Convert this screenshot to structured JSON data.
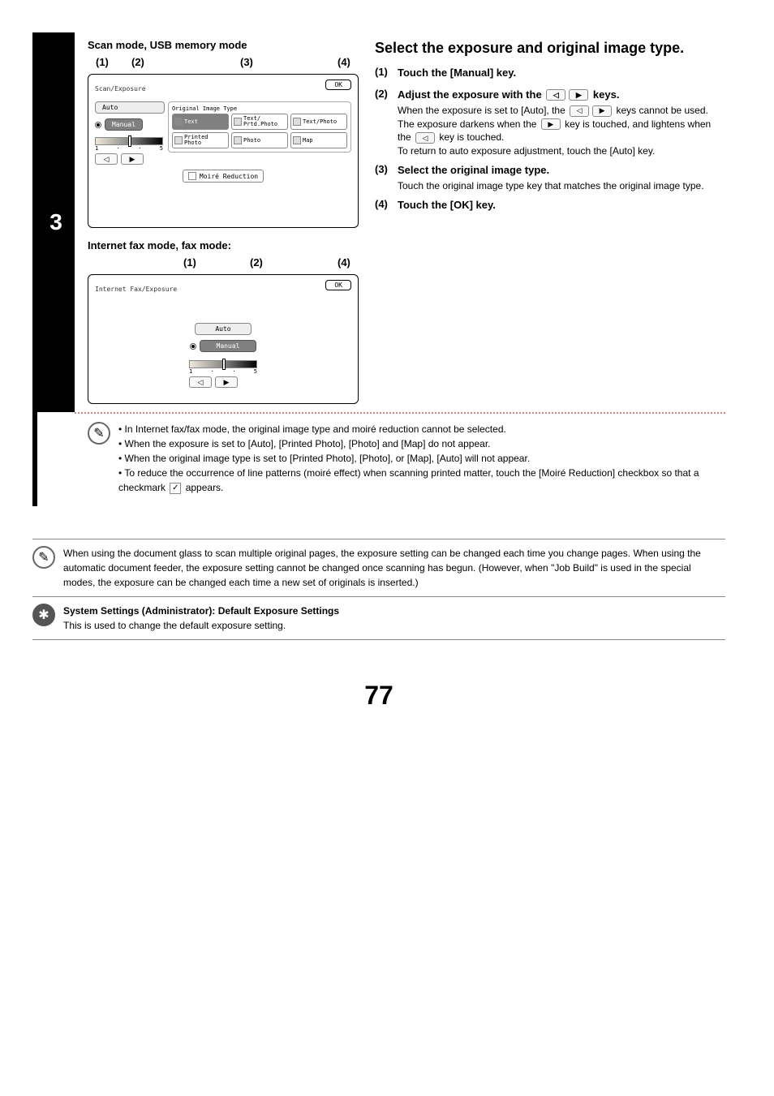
{
  "modeTitle1": "Scan mode, USB memory mode",
  "modeTitle2": "Internet fax mode, fax mode:",
  "callouts": {
    "c1": "(1)",
    "c2": "(2)",
    "c3": "(3)",
    "c4": "(4)"
  },
  "panel1": {
    "header": "Scan/Exposure",
    "ok": "OK",
    "auto": "Auto",
    "manual": "Manual",
    "origTitle": "Original Image Type",
    "types": {
      "text": "Text",
      "textPrtd": "Text/\nPrtd.Photo",
      "textPhoto": "Text/Photo",
      "printed": "Printed\nPhoto",
      "photo": "Photo",
      "map": "Map"
    },
    "scale": {
      "min": "1",
      "max": "5"
    },
    "moire": "Moiré Reduction"
  },
  "panel2": {
    "header": "Internet Fax/Exposure",
    "ok": "OK",
    "auto": "Auto",
    "manual": "Manual",
    "scale": {
      "min": "1",
      "max": "5"
    }
  },
  "stepNum": "3",
  "heading": "Select the exposure and original image type.",
  "sub1": {
    "num": "(1)",
    "title": "Touch the [Manual] key."
  },
  "sub2": {
    "num": "(2)",
    "titlePrefix": "Adjust the exposure with the ",
    "titleSuffix": " keys.",
    "desc1a": "When the exposure is set to [Auto], the ",
    "desc1b": " keys cannot be used.",
    "desc2a": "The exposure darkens when the ",
    "desc2b": " key is touched, and lightens when the ",
    "desc2c": " key is touched.",
    "desc3": "To return to auto exposure adjustment, touch the [Auto] key."
  },
  "sub3": {
    "num": "(3)",
    "title": "Select the original image type.",
    "desc": "Touch the original image type key that matches the original image type."
  },
  "sub4": {
    "num": "(4)",
    "title": "Touch the [OK] key."
  },
  "notes": {
    "n1": "In Internet fax/fax mode, the original image type and moiré reduction cannot be selected.",
    "n2": "When the exposure is set to [Auto], [Printed Photo], [Photo] and [Map] do not appear.",
    "n3": "When the original image type is set to [Printed Photo], [Photo], or [Map], [Auto] will not appear.",
    "n4a": "To reduce the occurrence of line patterns (moiré effect) when scanning printed matter, touch the [Moiré Reduction] checkbox so that a checkmark ",
    "n4b": " appears."
  },
  "foot1": "When using the document glass to scan multiple original pages, the exposure setting can be changed each time you change pages. When using the automatic document feeder, the exposure setting cannot be changed once scanning has begun. (However, when \"Job Build\" is used in the special modes, the exposure can be changed each time a new set of originals is inserted.)",
  "foot2title": "System Settings (Administrator): Default Exposure Settings",
  "foot2desc": "This is used to change the default exposure setting.",
  "pageNum": "77"
}
